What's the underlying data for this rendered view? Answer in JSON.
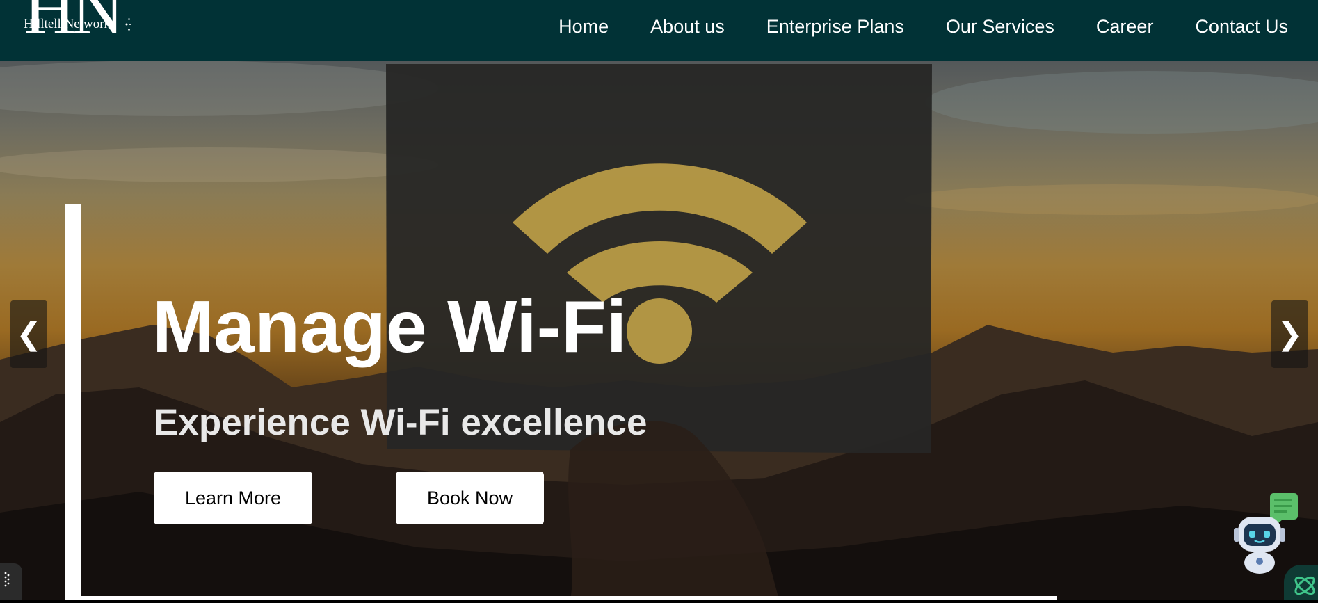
{
  "brand": {
    "name": "Hilltell Network",
    "logo_initials": "HN"
  },
  "nav": {
    "items": [
      {
        "label": "Home"
      },
      {
        "label": "About us"
      },
      {
        "label": "Enterprise Plans"
      },
      {
        "label": "Our Services"
      },
      {
        "label": "Career"
      },
      {
        "label": "Contact Us"
      }
    ]
  },
  "hero": {
    "title": "Manage Wi-Fi",
    "subtitle": "Experience Wi-Fi excellence",
    "learn_more_label": "Learn More",
    "book_now_label": "Book Now",
    "prev_arrow": "❮",
    "next_arrow": "❯",
    "background_image": "wifi-sign-sunset-photo"
  },
  "widgets": {
    "chatbot_icon": "chatbot-robot-icon",
    "corner_widget_icon": "grip-dots-icon",
    "corner_logo_icon": "leaf-logo-icon"
  },
  "colors": {
    "header_bg": "#013236",
    "button_bg": "#ffffff",
    "wifi_symbol": "#c9a84a"
  }
}
